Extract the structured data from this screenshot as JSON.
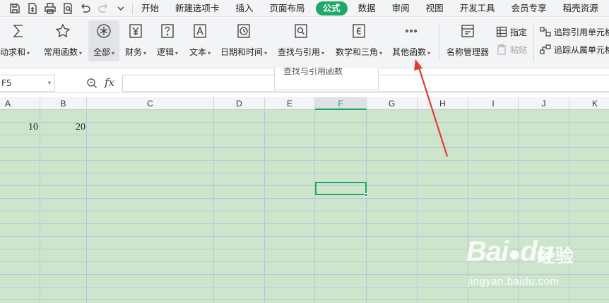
{
  "quick_access": [
    {
      "name": "save-icon"
    },
    {
      "name": "export-pdf-icon"
    },
    {
      "name": "print-icon"
    },
    {
      "name": "print-preview-icon"
    },
    {
      "name": "undo-icon"
    },
    {
      "name": "redo-icon"
    },
    {
      "name": "customize-dropdown-icon"
    }
  ],
  "menu_tabs": [
    "开始",
    "新建选项卡",
    "插入",
    "页面布局",
    "公式",
    "数据",
    "审阅",
    "视图",
    "开发工具",
    "会员专享",
    "稻壳资源"
  ],
  "active_tab": "公式",
  "ribbon": {
    "autosum": "自动求和",
    "common_functions": "常用函数",
    "all": "全部",
    "finance": "财务",
    "logic": "逻辑",
    "text": "文本",
    "datetime": "日期和时间",
    "lookup": "查找与引用",
    "math": "数学和三角",
    "other": "其他函数",
    "name_manager": "名称管理器",
    "specify": "指定",
    "paste": "粘贴",
    "trace_precedents": "追踪引用单元格",
    "trace_dependents": "追踪从属单元格"
  },
  "formula_bar": {
    "name_box": "F5",
    "fx": "fx",
    "tooltip": "查找与引用函数"
  },
  "columns": [
    "A",
    "B",
    "C",
    "D",
    "E",
    "F",
    "G",
    "H",
    "I",
    "J",
    "K"
  ],
  "active_column": "F",
  "cells": {
    "A1": "10",
    "B1": "20"
  },
  "watermark": {
    "logo": "Bai",
    "logo_suffix": "du",
    "chinese": "经验",
    "url": "jingyan.baidu.com"
  },
  "colors": {
    "accent": "#1ea86a",
    "sheet_bg": "#cde6cb",
    "annotation": "#e53935"
  }
}
